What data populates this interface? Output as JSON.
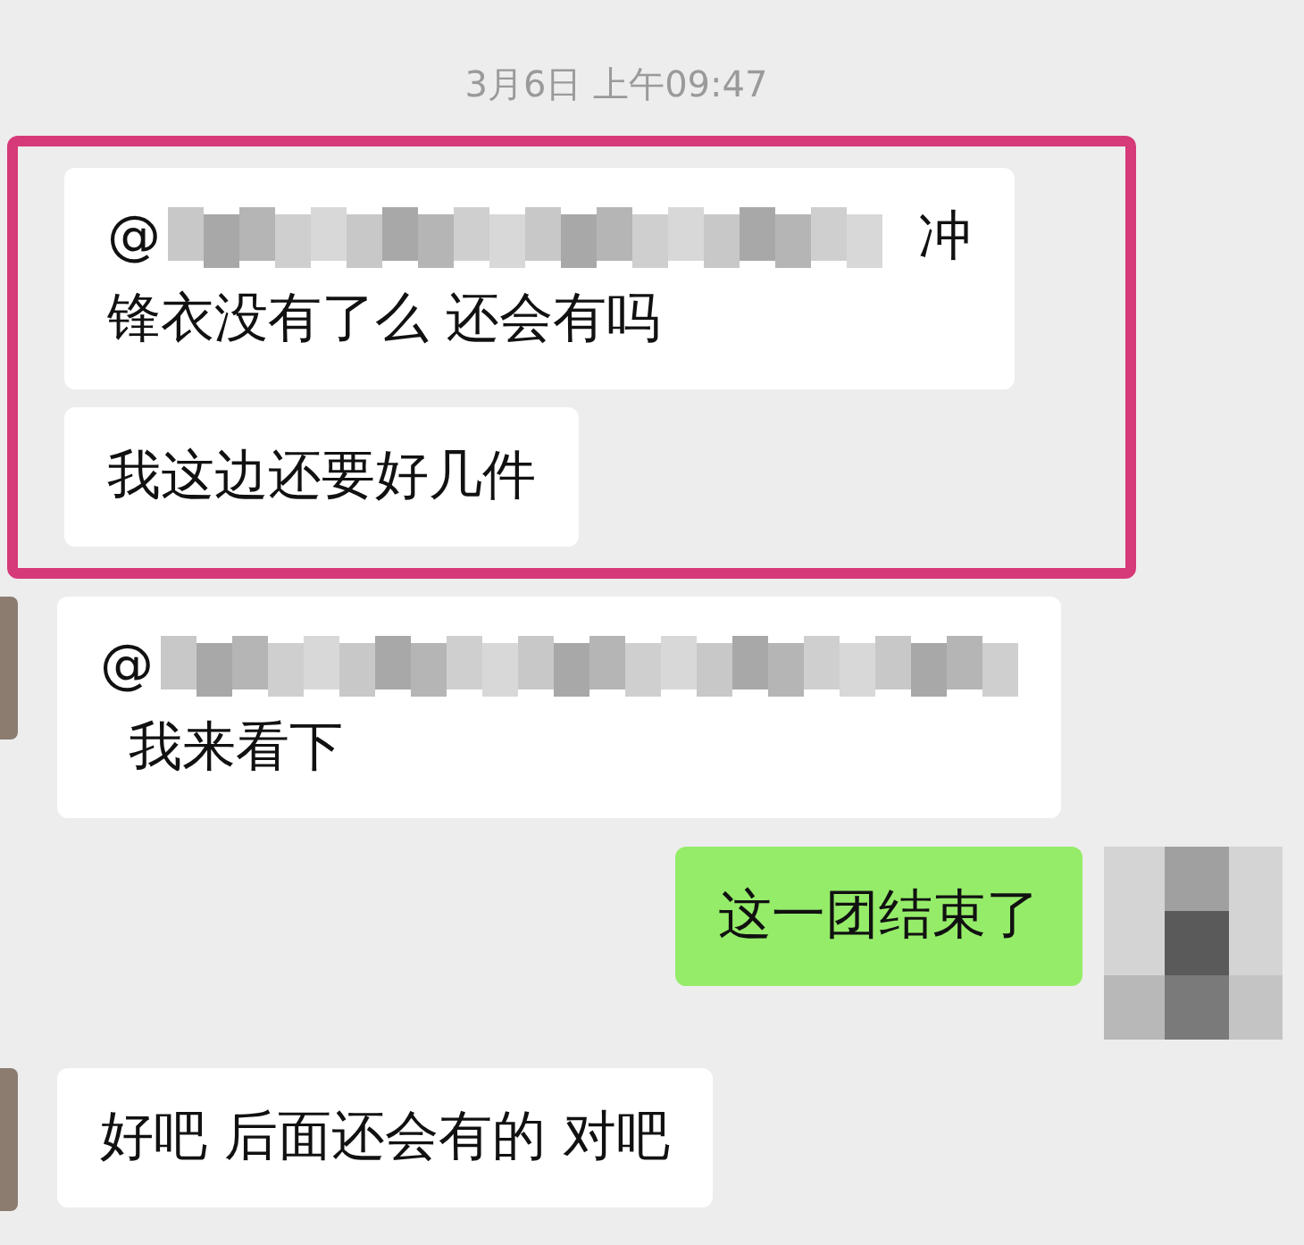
{
  "timestamp": "3月6日 上午09:47",
  "messages": [
    {
      "outgoing": false,
      "highlighted": true,
      "mention": {
        "prefix": "@",
        "suffix": "冲"
      },
      "text": "锋衣没有了么 还会有吗"
    },
    {
      "outgoing": false,
      "highlighted": true,
      "text": "我这边还要好几件"
    },
    {
      "outgoing": false,
      "highlighted": false,
      "mention": {
        "prefix": "@"
      },
      "text": "我来看下"
    },
    {
      "outgoing": true,
      "highlighted": false,
      "text": "这一团结束了"
    },
    {
      "outgoing": false,
      "highlighted": false,
      "text": "好吧 后面还会有的 对吧"
    }
  ]
}
